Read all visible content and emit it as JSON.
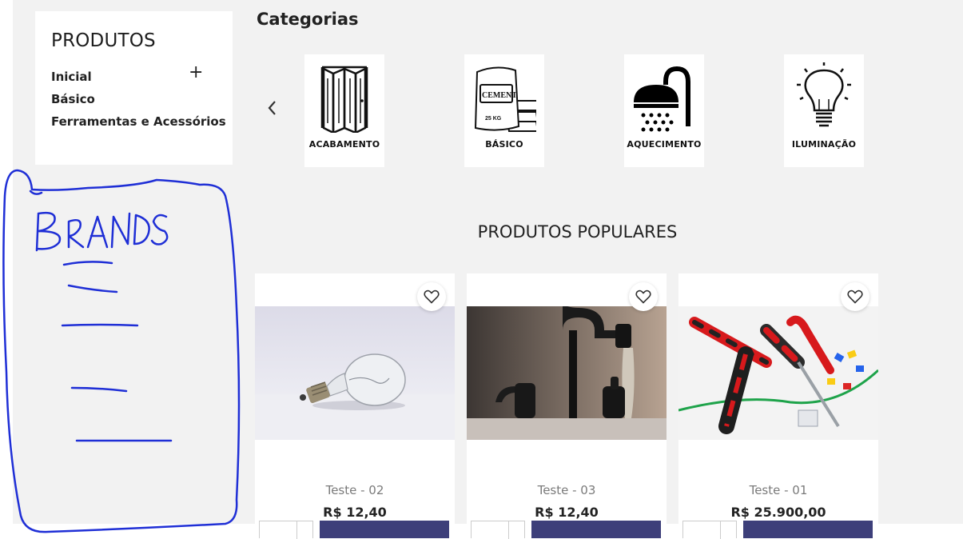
{
  "sidebar": {
    "title": "PRODUTOS",
    "items": [
      {
        "label": "Inicial"
      },
      {
        "label": "Básico"
      },
      {
        "label": "Ferramentas e Acessórios"
      }
    ],
    "expand_symbol": "+"
  },
  "categories": {
    "title": "Categorias",
    "prev_symbol": "‹",
    "next_symbol": "›",
    "items": [
      {
        "label": "ACABAMENTO",
        "icon": "folding-door-icon"
      },
      {
        "label": "BÁSICO",
        "icon": "cement-bag-icon"
      },
      {
        "label": "AQUECIMENTO",
        "icon": "shower-icon"
      },
      {
        "label": "ILUMINAÇÃO",
        "icon": "light-bulb-icon"
      }
    ]
  },
  "popular": {
    "title": "PRODUTOS POPULARES",
    "products": [
      {
        "name": "Teste - 02",
        "price": "R$ 12,40",
        "image": "light-bulb-photo"
      },
      {
        "name": "Teste - 03",
        "price": "R$ 12,40",
        "image": "water-faucet-photo"
      },
      {
        "name": "Teste - 01",
        "price": "R$ 25.900,00",
        "image": "tools-photo"
      }
    ]
  },
  "cement_bag_text": {
    "line1": "CEMENT",
    "line2": "25 KG"
  },
  "annotation": {
    "text": "BRANDS",
    "color": "#1f2fd6"
  },
  "colors": {
    "cart_button": "#3d3f7a",
    "page_bg": "#f2f2f2"
  }
}
